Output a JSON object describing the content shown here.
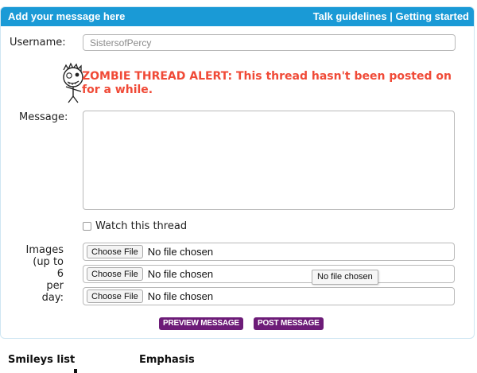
{
  "header": {
    "title": "Add your message here",
    "link_guidelines": "Talk guidelines",
    "separator": "|",
    "link_getting_started": "Getting started"
  },
  "form": {
    "username_label": "Username:",
    "username_value": "SistersofPercy",
    "alert_text": "ZOMBIE THREAD ALERT: This thread hasn't been posted on for a while.",
    "message_label": "Message:",
    "message_value": "",
    "watch_label": "Watch this thread",
    "watch_checked": false,
    "images_label_line1": "Images",
    "images_label_line2": "(up to 6",
    "images_label_line3": "per day:",
    "file_inputs": [
      {
        "button": "Choose File",
        "status": "No file chosen"
      },
      {
        "button": "Choose File",
        "status": "No file chosen"
      },
      {
        "button": "Choose File",
        "status": "No file chosen"
      }
    ],
    "tooltip": "No file chosen",
    "preview_button": "PREVIEW MESSAGE",
    "post_button": "POST MESSAGE"
  },
  "footer": {
    "smileys": "Smileys list",
    "emphasis": "Emphasis"
  },
  "colors": {
    "header_bg": "#1a9ad6",
    "alert": "#f04a37",
    "action_button": "#6d1c78"
  },
  "icons": {
    "zombie": "zombie-icon"
  }
}
